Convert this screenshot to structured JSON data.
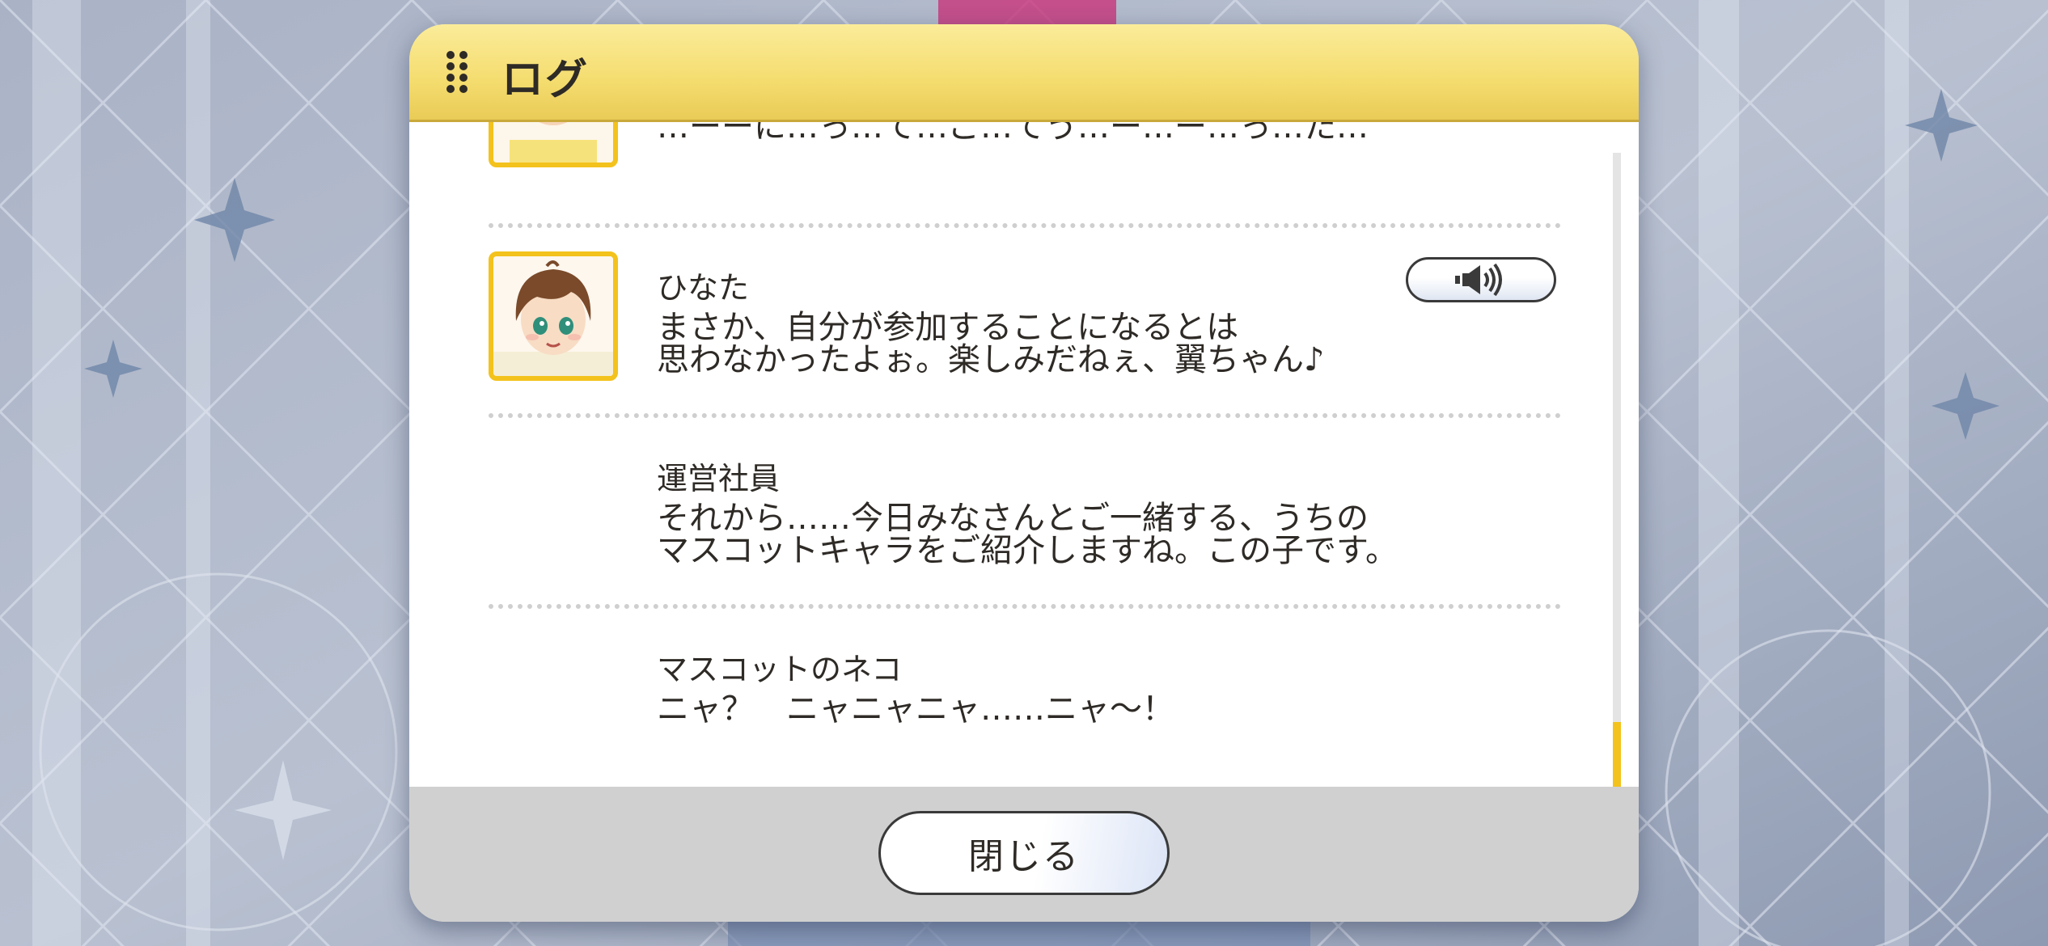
{
  "dialog": {
    "title": "ログ",
    "close_label": "閉じる"
  },
  "log": [
    {
      "speaker": "",
      "lines": [
        "…ーーに…っ…て…ご…てう…ー…ー…っ…た…"
      ],
      "has_avatar": true,
      "has_voice": false
    },
    {
      "speaker": "ひなた",
      "lines": [
        "まさか、自分が参加することになるとは",
        "思わなかったよぉ。楽しみだねぇ、翼ちゃん♪"
      ],
      "has_avatar": true,
      "has_voice": true
    },
    {
      "speaker": "運営社員",
      "lines": [
        "それから……今日みなさんとご一緒する、うちの",
        "マスコットキャラをご紹介しますね。この子です。"
      ],
      "has_avatar": false,
      "has_voice": false
    },
    {
      "speaker": "マスコットのネコ",
      "lines": [
        "ニャ？　ニャニャニャ……ニャ～！"
      ],
      "has_avatar": false,
      "has_voice": false
    }
  ],
  "scroll": {
    "position": 0.88,
    "visible_fraction": 0.12
  },
  "colors": {
    "accent_gold": "#f3c21c",
    "header_gold": "#f4dc6e",
    "text": "#2e2a26"
  },
  "icons": {
    "grip": "grip-dots-icon",
    "voice": "speaker-icon"
  }
}
